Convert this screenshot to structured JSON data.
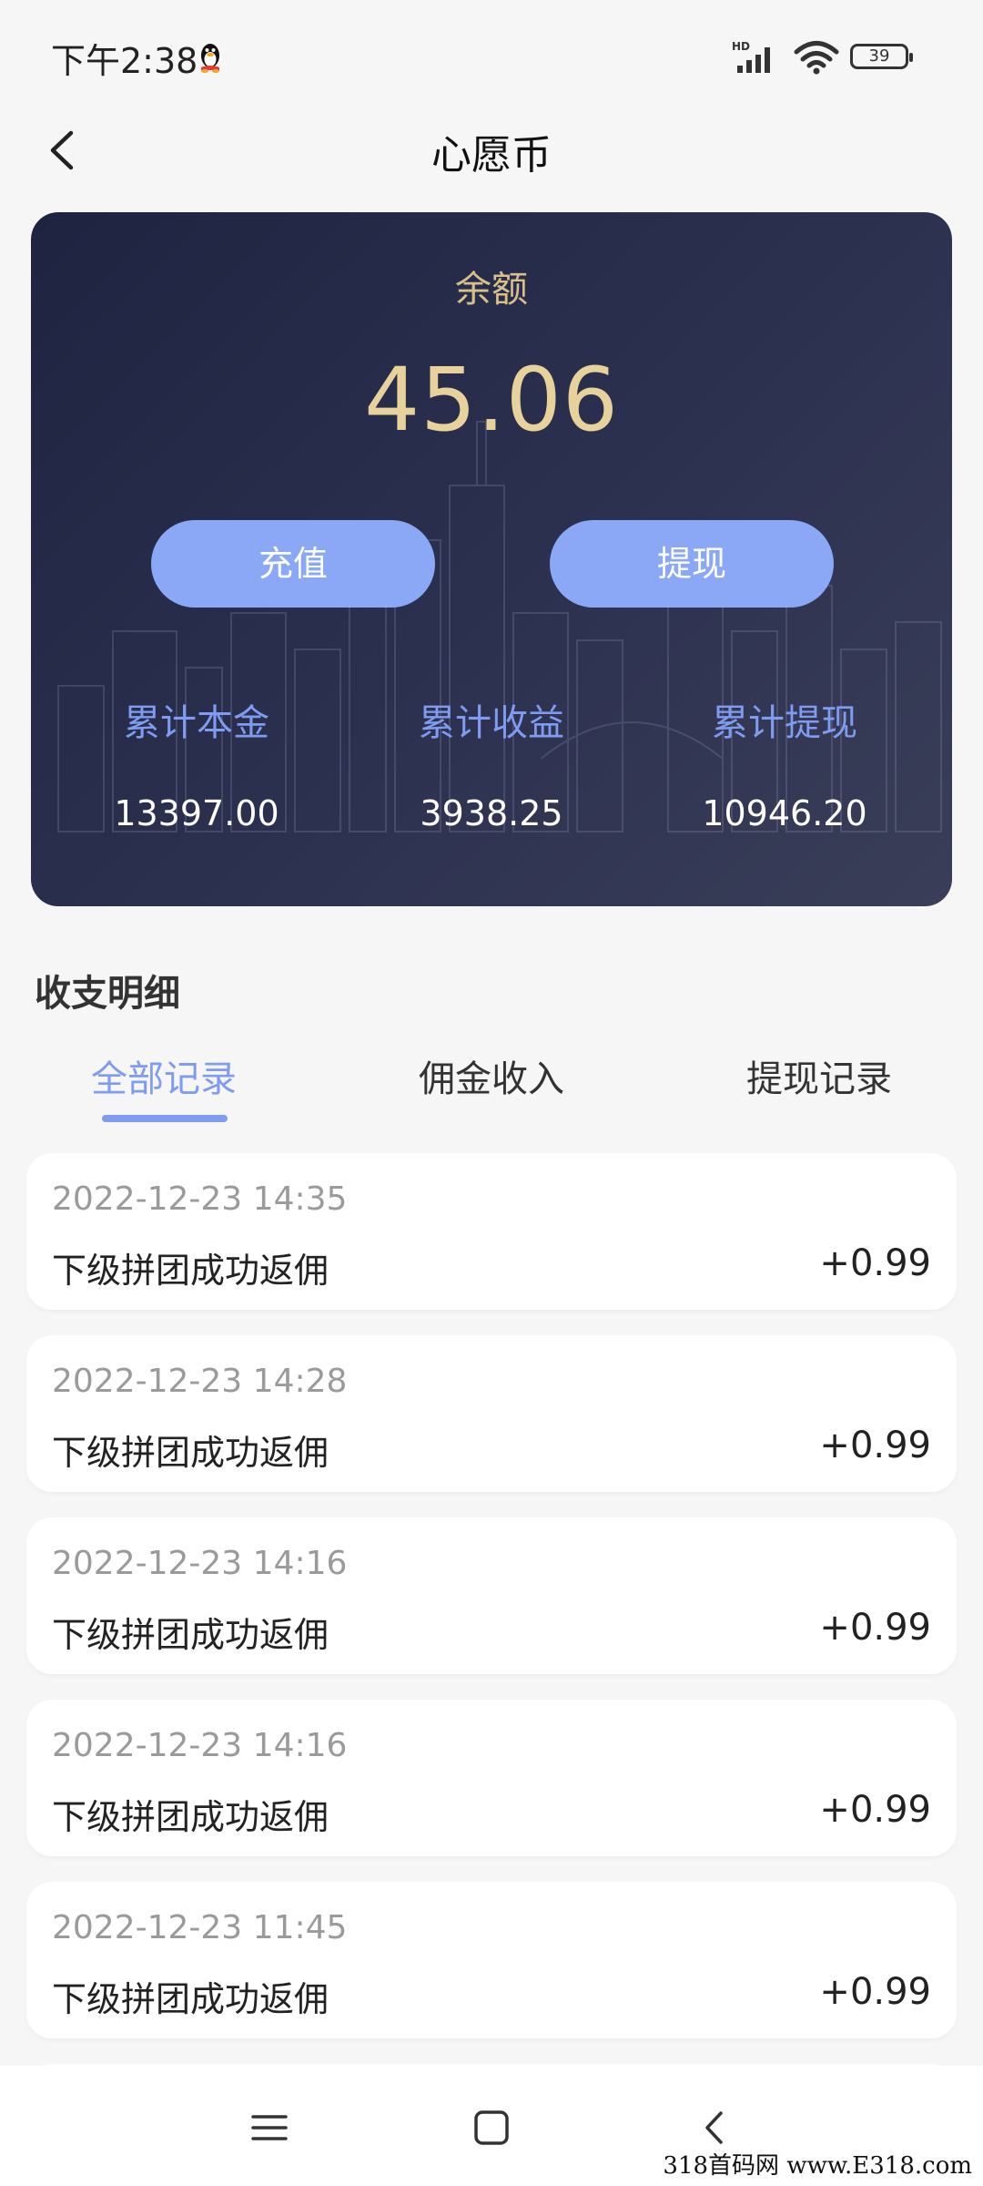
{
  "status_bar": {
    "time": "下午2:38",
    "network": "HD",
    "battery": "39"
  },
  "header": {
    "title": "心愿币"
  },
  "balance_card": {
    "label": "余额",
    "amount": "45.06",
    "recharge_label": "充值",
    "withdraw_label": "提现",
    "stats": [
      {
        "label": "累计本金",
        "value": "13397.00"
      },
      {
        "label": "累计收益",
        "value": "3938.25"
      },
      {
        "label": "累计提现",
        "value": "10946.20"
      }
    ]
  },
  "section": {
    "title": "收支明细",
    "tabs": [
      {
        "label": "全部记录",
        "active": true
      },
      {
        "label": "佣金收入",
        "active": false
      },
      {
        "label": "提现记录",
        "active": false
      }
    ]
  },
  "records": [
    {
      "time": "2022-12-23 14:35",
      "desc": "下级拼团成功返佣",
      "amount": "+0.99"
    },
    {
      "time": "2022-12-23 14:28",
      "desc": "下级拼团成功返佣",
      "amount": "+0.99"
    },
    {
      "time": "2022-12-23 14:16",
      "desc": "下级拼团成功返佣",
      "amount": "+0.99"
    },
    {
      "time": "2022-12-23 14:16",
      "desc": "下级拼团成功返佣",
      "amount": "+0.99"
    },
    {
      "time": "2022-12-23 11:45",
      "desc": "下级拼团成功返佣",
      "amount": "+0.99"
    }
  ],
  "colors": {
    "accent": "#7f9cf0",
    "button": "#8aa8f5",
    "gold": "#e8d29c",
    "card_bg": "#23284a"
  },
  "watermark": "318首码网 www.E318.com"
}
